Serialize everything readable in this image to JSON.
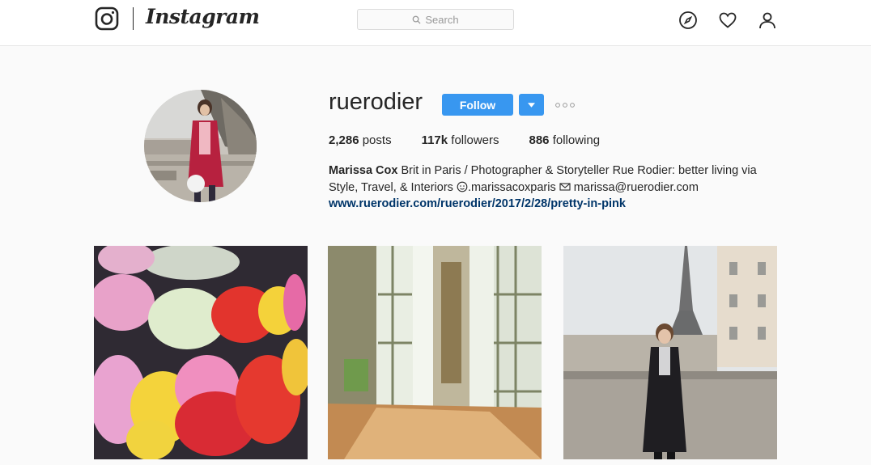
{
  "nav": {
    "wordmark": "Instagram",
    "search_placeholder": "Search",
    "icons": [
      "instagram-logo-icon",
      "search-icon",
      "compass-icon",
      "heart-icon",
      "user-icon"
    ]
  },
  "profile": {
    "username": "ruerodier",
    "follow_label": "Follow",
    "stats": {
      "posts_count": "2,286",
      "posts_label": "posts",
      "followers_count": "117k",
      "followers_label": "followers",
      "following_count": "886",
      "following_label": "following"
    },
    "bio": {
      "full_name": "Marissa Cox",
      "line1": "Brit in Paris / Photographer & Storyteller Rue Rodier: better living via",
      "line2_prefix": "Style, Travel, & Interiors",
      "instagram_handle": ".marissacoxparis",
      "email": "marissa@ruerodier.com",
      "link": "www.ruerodier.com/ruerodier/2017/2/28/pretty-in-pink"
    }
  },
  "posts": [
    {
      "subject": "flower market roses"
    },
    {
      "subject": "sunlit parquet room with tall windows"
    },
    {
      "subject": "woman in black coat near Eiffel Tower"
    }
  ],
  "colors": {
    "accent": "#3897f0",
    "link": "#003569",
    "text": "#262626",
    "background": "#fafafa"
  }
}
